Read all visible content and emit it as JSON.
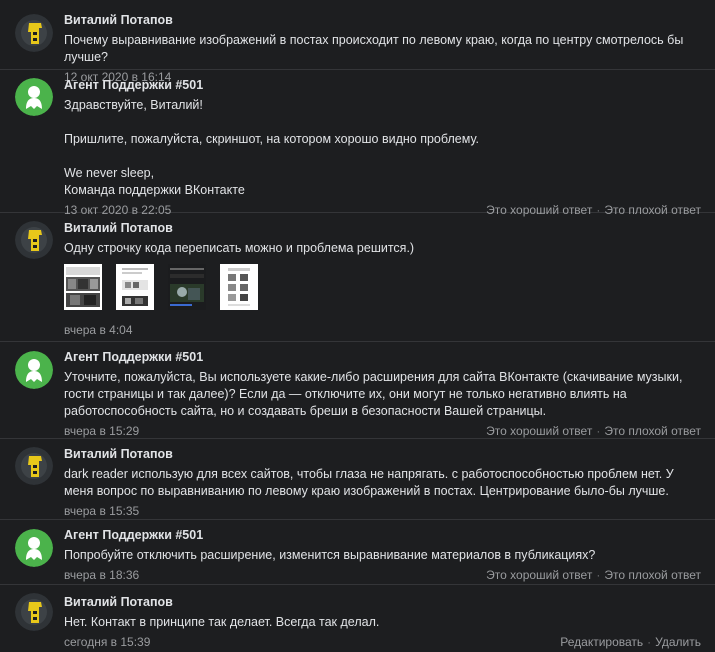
{
  "messages": [
    {
      "author": "Виталий Потапов",
      "avatar": "user-avatar-icon",
      "text": "Почему выравнивание изображений в постах происходит по левому краю, когда по центру смотрелось бы лучше?",
      "date": "12 окт 2020 в 16:14"
    },
    {
      "author": "Агент Поддержки #501",
      "avatar": "support-agent-avatar-icon",
      "text": "Здравствуйте, Виталий!\n\nПришлите, пожалуйста, скриншот, на котором хорошо видно проблему.\n\nWe never sleep,\nКоманда поддержки ВКонтакте",
      "date": "13 окт 2020 в 22:05",
      "good": "Это хороший ответ",
      "bad": "Это плохой ответ"
    },
    {
      "author": "Виталий Потапов",
      "avatar": "user-avatar-icon",
      "text": "Одну строчку кода переписать можно и проблема решится.)",
      "date": "вчера в 4:04",
      "attachments": [
        "screenshot-1",
        "screenshot-2",
        "screenshot-3",
        "screenshot-4"
      ]
    },
    {
      "author": "Агент Поддержки #501",
      "avatar": "support-agent-avatar-icon",
      "text": "Уточните, пожалуйста, Вы используете какие-либо расширения для сайта ВКонтакте (скачивание музыки, гости страницы и так далее)? Если да — отключите их, они могут не только негативно влиять на работоспособность сайта, но и создавать бреши в безопасности Вашей страницы.",
      "date": "вчера в 15:29",
      "good": "Это хороший ответ",
      "bad": "Это плохой ответ"
    },
    {
      "author": "Виталий Потапов",
      "avatar": "user-avatar-icon",
      "text": "dark reader использую для всех сайтов, чтобы глаза не напрягать. с работоспособностью проблем нет. У меня вопрос по выравниванию по левому краю изображений в постах. Центрирование было-бы лучше.",
      "date": "вчера в 15:35"
    },
    {
      "author": "Агент Поддержки #501",
      "avatar": "support-agent-avatar-icon",
      "text": "Попробуйте отключить расширение, изменится выравнивание материалов в публикациях?",
      "date": "вчера в 18:36",
      "good": "Это хороший ответ",
      "bad": "Это плохой ответ"
    },
    {
      "author": "Виталий Потапов",
      "avatar": "user-avatar-icon",
      "text": "Нет. Контакт в принципе так делает. Всегда так делал.",
      "date": "сегодня в 15:39",
      "edit": "Редактировать",
      "delete": "Удалить"
    }
  ],
  "colors": {
    "background": "#1d1e20",
    "divider": "#343538",
    "text": "#e1e3e6",
    "secondary": "#9a9c9f",
    "agent_avatar": "#4bb34b",
    "user_avatar_accent": "#e8c81a"
  }
}
